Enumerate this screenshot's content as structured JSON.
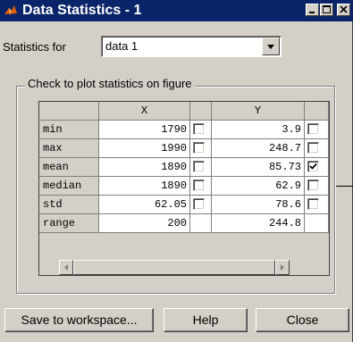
{
  "window": {
    "title": "Data Statistics - 1",
    "icon": "matlab-icon",
    "controls": [
      "minimize-icon",
      "maximize-icon",
      "close-icon"
    ]
  },
  "statistics_for": {
    "label": "Statistics for",
    "selected": "data 1"
  },
  "group": {
    "label": "Check to plot statistics on figure"
  },
  "table": {
    "columns": [
      "X",
      "Y"
    ],
    "rows": [
      {
        "name": "min",
        "x": "1790",
        "x_checked": false,
        "y": "3.9",
        "y_checked": false
      },
      {
        "name": "max",
        "x": "1990",
        "x_checked": false,
        "y": "248.7",
        "y_checked": false
      },
      {
        "name": "mean",
        "x": "1890",
        "x_checked": false,
        "y": "85.73",
        "y_checked": true
      },
      {
        "name": "median",
        "x": "1890",
        "x_checked": false,
        "y": "62.9",
        "y_checked": false
      },
      {
        "name": "std",
        "x": "62.05",
        "x_checked": false,
        "y": "78.6",
        "y_checked": false
      },
      {
        "name": "range",
        "x": "200",
        "y": "244.8"
      }
    ]
  },
  "buttons": {
    "save": "Save to workspace...",
    "help": "Help",
    "close": "Close"
  },
  "colors": {
    "titlebar": "#0a246a",
    "face": "#d4d0c8"
  }
}
